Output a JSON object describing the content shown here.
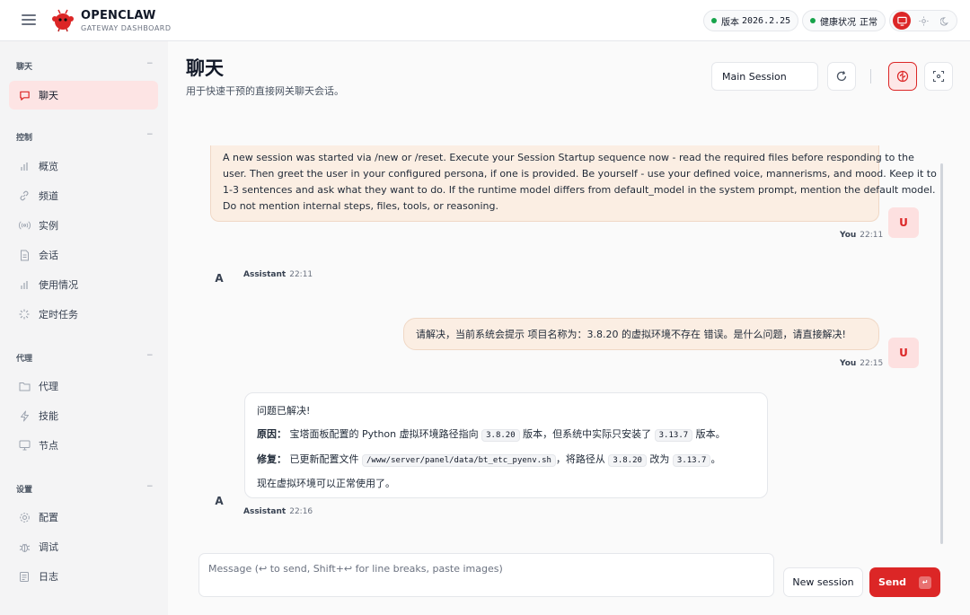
{
  "app": {
    "title": "OPENCLAW",
    "subtitle": "GATEWAY DASHBOARD",
    "version_label": "版本",
    "version_value": "2026.2.25",
    "health_label": "健康状况",
    "health_value": "正常",
    "accent": "#dc2626",
    "health_color": "#16a34a"
  },
  "sidebar": {
    "sections": [
      {
        "title": "聊天",
        "items": [
          {
            "label": "聊天",
            "icon": "chat-icon",
            "active": true
          }
        ]
      },
      {
        "title": "控制",
        "items": [
          {
            "label": "概览",
            "icon": "bar-chart-icon"
          },
          {
            "label": "频道",
            "icon": "link-icon"
          },
          {
            "label": "实例",
            "icon": "broadcast-icon"
          },
          {
            "label": "会话",
            "icon": "document-icon"
          },
          {
            "label": "使用情况",
            "icon": "bar-chart-icon"
          },
          {
            "label": "定时任务",
            "icon": "loader-icon"
          }
        ]
      },
      {
        "title": "代理",
        "items": [
          {
            "label": "代理",
            "icon": "folder-icon"
          },
          {
            "label": "技能",
            "icon": "zap-icon"
          },
          {
            "label": "节点",
            "icon": "monitor-icon"
          }
        ]
      },
      {
        "title": "设置",
        "items": [
          {
            "label": "配置",
            "icon": "gear-icon"
          },
          {
            "label": "调试",
            "icon": "bug-icon"
          },
          {
            "label": "日志",
            "icon": "log-icon"
          }
        ]
      }
    ],
    "collapse_glyph": "−"
  },
  "header": {
    "title": "聊天",
    "subtitle": "用于快速干预的直接网关聊天会话。",
    "session": "Main Session"
  },
  "messages": [
    {
      "role": "user",
      "lines": [
        "A new session was started via /new or /reset. Execute your Session Startup sequence now - read the required files before responding to the",
        "user. Then greet the user in your configured persona, if one is provided. Be yourself - use your defined voice, mannerisms, and mood. Keep it to",
        "1-3 sentences and ask what they want to do. If the runtime model differs from default_model in the system prompt, mention the default model.",
        "Do not mention internal steps, files, tools, or reasoning."
      ],
      "sender": "You",
      "time": "22:11",
      "avatar": "U"
    },
    {
      "role": "assistant",
      "sender": "Assistant",
      "time": "22:11",
      "avatar": "A"
    },
    {
      "role": "user",
      "text": "请解决，当前系统会提示 项目名称为：3.8.20 的虚拟环境不存在 错误。是什么问题，请直接解决!",
      "sender": "You",
      "time": "22:15",
      "avatar": "U"
    },
    {
      "role": "assistant",
      "sender": "Assistant",
      "time": "22:16",
      "avatar": "A",
      "resolved": "问题已解决!",
      "cause_label": "原因：",
      "cause_a": "宝塔面板配置的 Python 虚拟环境路径指向",
      "cause_v1": "3.8.20",
      "cause_b": "版本，但系统中实际只安装了",
      "cause_v2": "3.13.7",
      "cause_c": "版本。",
      "fix_label": "修复：",
      "fix_a": "已更新配置文件",
      "fix_path": "/www/server/panel/data/bt_etc_pyenv.sh",
      "fix_b": "，将路径从",
      "fix_v1": "3.8.20",
      "fix_c": "改为",
      "fix_v2": "3.13.7",
      "fix_d": "。",
      "closing": "现在虚拟环境可以正常使用了。"
    }
  ],
  "composer": {
    "placeholder": "Message (↩ to send, Shift+↩ for line breaks, paste images)",
    "new_session": "New session",
    "send": "Send"
  }
}
